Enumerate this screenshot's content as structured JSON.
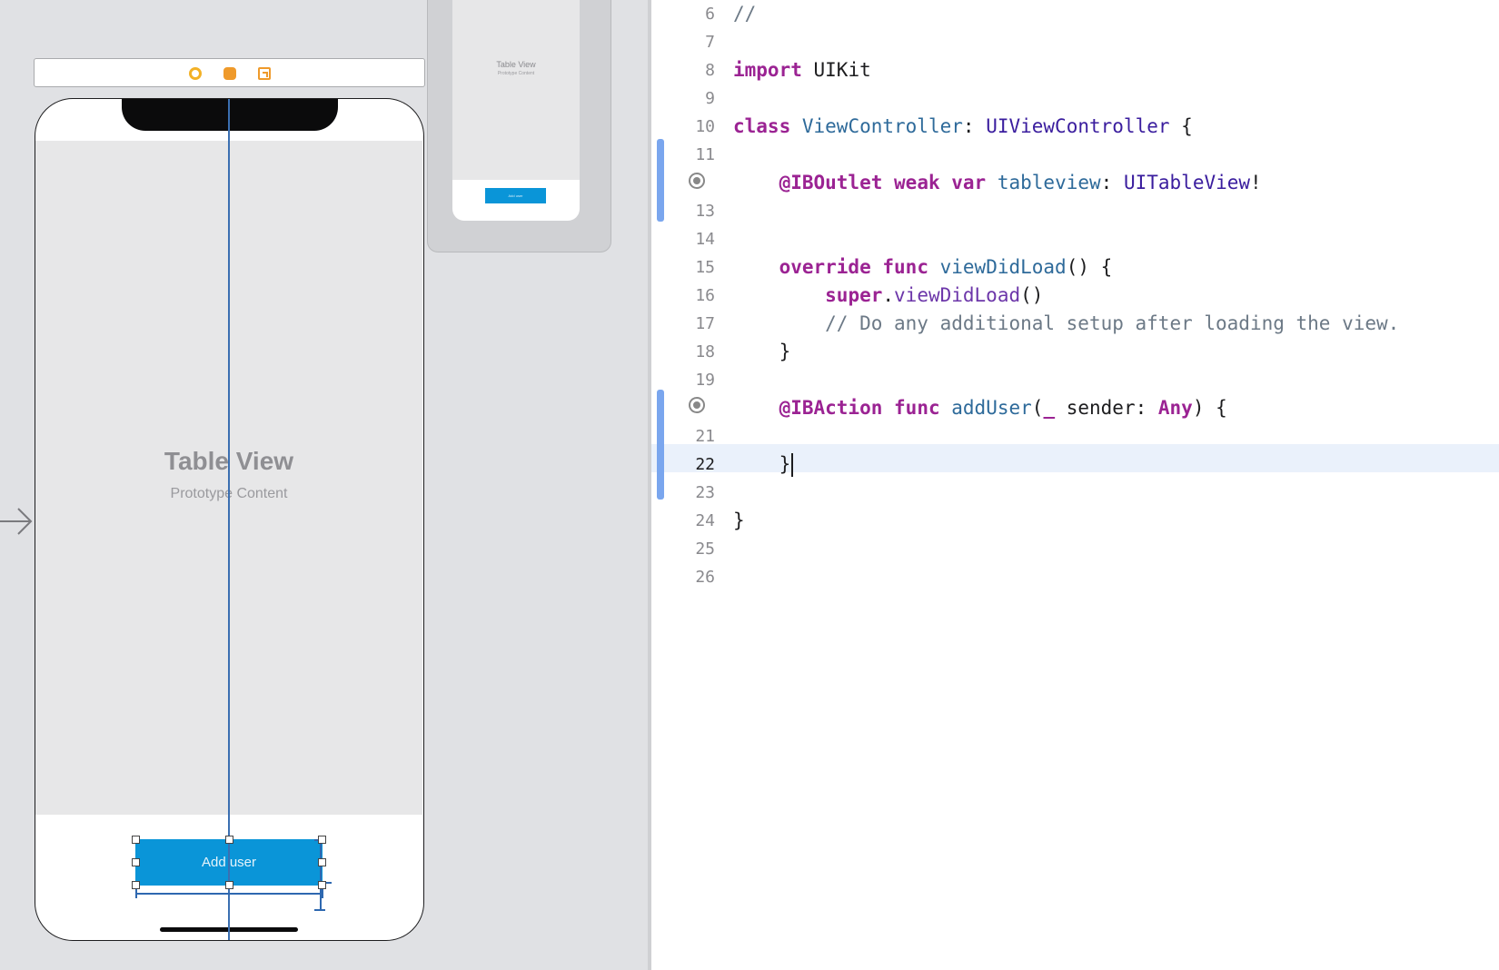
{
  "storyboard": {
    "mini_scene": {
      "title": "Table View",
      "subtitle": "Prototype Content",
      "button_label": "Add user"
    },
    "scene_dock": {
      "icons": [
        "view-controller-icon",
        "first-responder-icon",
        "exit-icon"
      ]
    },
    "entry_arrow": "→",
    "table_view": {
      "title": "Table View",
      "subtitle": "Prototype Content"
    },
    "add_button": {
      "label": "Add user",
      "color": "#0a95d8"
    }
  },
  "editor": {
    "active_line": "22",
    "lines": [
      {
        "num": "6",
        "text": "//"
      },
      {
        "num": "7",
        "text": ""
      },
      {
        "num": "8",
        "text": "import UIKit"
      },
      {
        "num": "9",
        "text": ""
      },
      {
        "num": "10",
        "text": "class ViewController: UIViewController {"
      },
      {
        "num": "11",
        "text": ""
      },
      {
        "num": "12",
        "text": "    @IBOutlet weak var tableview: UITableView!",
        "connection_marker": true
      },
      {
        "num": "13",
        "text": ""
      },
      {
        "num": "14",
        "text": ""
      },
      {
        "num": "15",
        "text": "    override func viewDidLoad() {"
      },
      {
        "num": "16",
        "text": "        super.viewDidLoad()"
      },
      {
        "num": "17",
        "text": "        // Do any additional setup after loading the view."
      },
      {
        "num": "18",
        "text": "    }"
      },
      {
        "num": "19",
        "text": ""
      },
      {
        "num": "20",
        "text": "    @IBAction func addUser(_ sender: Any) {",
        "connection_marker": true
      },
      {
        "num": "21",
        "text": ""
      },
      {
        "num": "22",
        "text": "    }"
      },
      {
        "num": "23",
        "text": ""
      },
      {
        "num": "24",
        "text": "}"
      },
      {
        "num": "25",
        "text": ""
      },
      {
        "num": "26",
        "text": ""
      }
    ],
    "tokens": {
      "l6_comment": "//",
      "l8_kw": "import",
      "l8_mod": "UIKit",
      "l10_kw": "class",
      "l10_name": "ViewController",
      "l10_colon": ":",
      "l10_super": "UIViewController",
      "l10_brace": "{",
      "l12_attr": "@IBOutlet",
      "l12_weak": "weak",
      "l12_var": "var",
      "l12_name": "tableview",
      "l12_colon": ":",
      "l12_type": "UITableView",
      "l12_bang": "!",
      "l15_override": "override",
      "l15_func": "func",
      "l15_name": "viewDidLoad",
      "l15_rest": "() {",
      "l16_super": "super",
      "l16_dot": ".",
      "l16_call": "viewDidLoad",
      "l16_parens": "()",
      "l17_comment": "// Do any additional setup after loading the view.",
      "l18_brace": "}",
      "l20_attr": "@IBAction",
      "l20_func": "func",
      "l20_name": "addUser",
      "l20_paren": "(",
      "l20_underscore": "_",
      "l20_param": " sender: ",
      "l20_type": "Any",
      "l20_rest": ") {",
      "l22_brace": "}",
      "l24_brace": "}"
    }
  }
}
